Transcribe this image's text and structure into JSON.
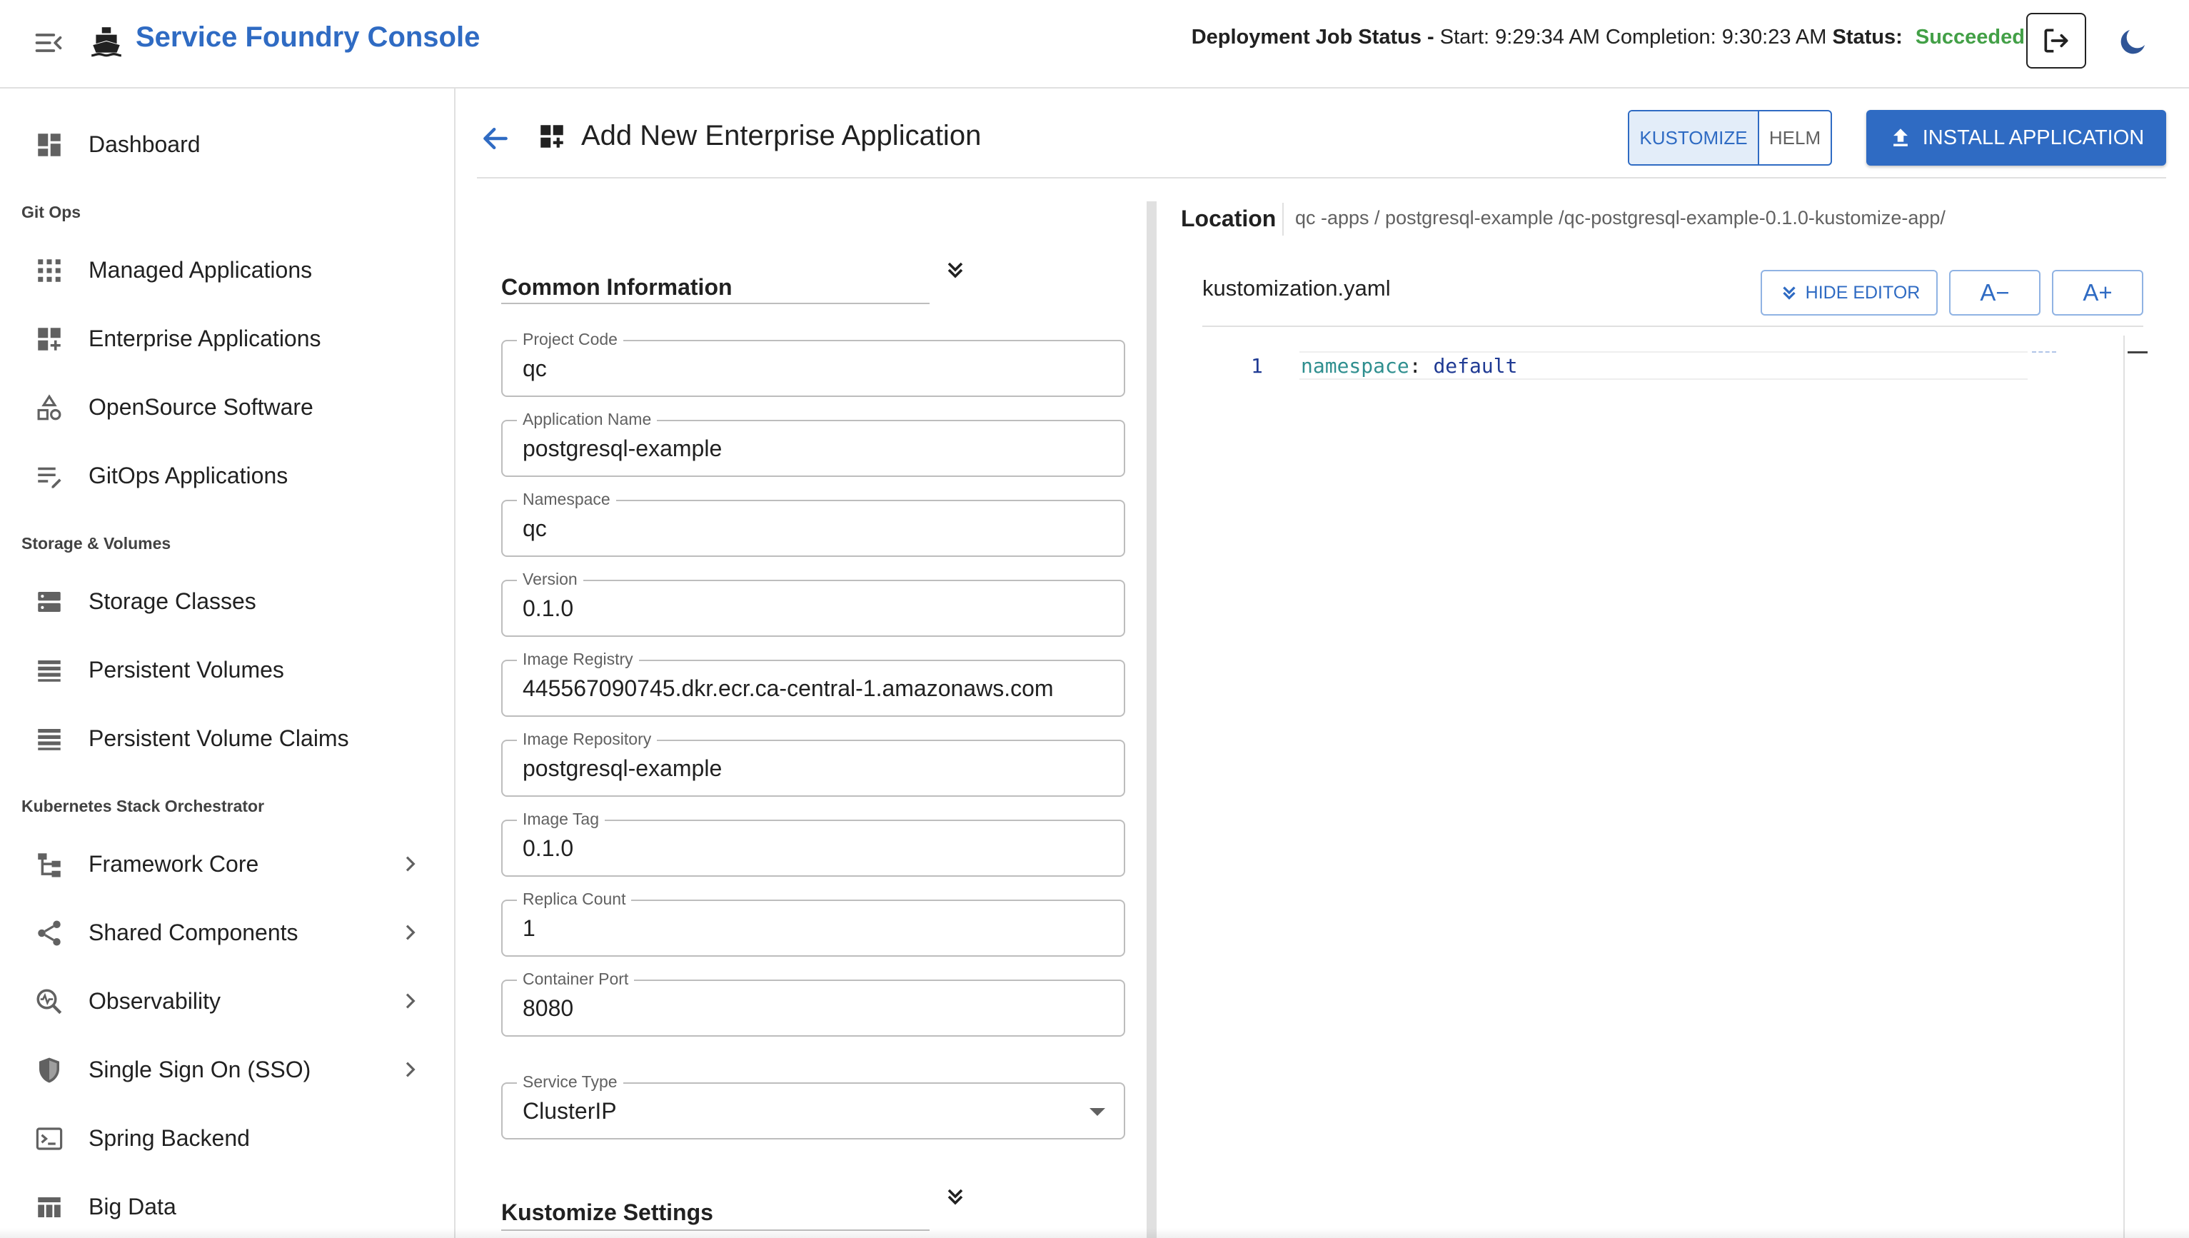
{
  "app": {
    "title": "Service Foundry Console",
    "accent_color": "#2f6bc3",
    "success_color": "#43a047"
  },
  "job_status": {
    "label": "Deployment Job Status -",
    "start": "Start: 9:29:34 AM",
    "completion": "Completion: 9:30:23 AM",
    "status_label": "Status:",
    "status_value": "Succeeded"
  },
  "sidebar": {
    "dashboard": {
      "label": "Dashboard",
      "icon": "dashboard-icon"
    },
    "sections": [
      {
        "title": "Git Ops",
        "items": [
          {
            "label": "Managed Applications",
            "icon": "apps-grid-icon"
          },
          {
            "label": "Enterprise Applications",
            "icon": "widgets-add-icon"
          },
          {
            "label": "OpenSource Software",
            "icon": "shapes-icon"
          },
          {
            "label": "GitOps Applications",
            "icon": "list-edit-icon"
          }
        ]
      },
      {
        "title": "Storage & Volumes",
        "items": [
          {
            "label": "Storage Classes",
            "icon": "storage-icon"
          },
          {
            "label": "Persistent Volumes",
            "icon": "list-icon"
          },
          {
            "label": "Persistent Volume Claims",
            "icon": "list-icon"
          }
        ]
      },
      {
        "title": "Kubernetes Stack Orchestrator",
        "items": [
          {
            "label": "Framework Core",
            "icon": "tree-icon",
            "expandable": true
          },
          {
            "label": "Shared Components",
            "icon": "share-icon",
            "expandable": true
          },
          {
            "label": "Observability",
            "icon": "monitor-search-icon",
            "expandable": true
          },
          {
            "label": "Single Sign On (SSO)",
            "icon": "shield-icon",
            "expandable": true
          },
          {
            "label": "Spring Backend",
            "icon": "terminal-icon",
            "expandable": false
          },
          {
            "label": "Big Data",
            "icon": "table-icon",
            "expandable": false
          }
        ]
      }
    ]
  },
  "page": {
    "title": "Add New Enterprise Application",
    "mode_options": [
      "KUSTOMIZE",
      "HELM"
    ],
    "selected_mode": "KUSTOMIZE",
    "install_label": "INSTALL APPLICATION"
  },
  "form": {
    "common_section_title": "Common Information",
    "kustomize_section_title": "Kustomize Settings",
    "fields": [
      {
        "label": "Project Code",
        "value": "qc"
      },
      {
        "label": "Application Name",
        "value": "postgresql-example"
      },
      {
        "label": "Namespace",
        "value": "qc"
      },
      {
        "label": "Version",
        "value": "0.1.0"
      },
      {
        "label": "Image Registry",
        "value": "445567090745.dkr.ecr.ca-central-1.amazonaws.com"
      },
      {
        "label": "Image Repository",
        "value": "postgresql-example"
      },
      {
        "label": "Image Tag",
        "value": "0.1.0"
      },
      {
        "label": "Replica Count",
        "value": "1"
      },
      {
        "label": "Container Port",
        "value": "8080"
      }
    ],
    "service_type": {
      "label": "Service Type",
      "value": "ClusterIP"
    }
  },
  "editor": {
    "location_label": "Location",
    "location_path": "qc -apps / postgresql-example /qc-postgresql-example-0.1.0-kustomize-app/",
    "file_name": "kustomization.yaml",
    "hide_editor_label": "HIDE EDITOR",
    "font_decrease_label": "A−",
    "font_increase_label": "A+",
    "lines": [
      {
        "number": "1",
        "key": "namespace",
        "punct": ":",
        "value": "default"
      }
    ]
  }
}
